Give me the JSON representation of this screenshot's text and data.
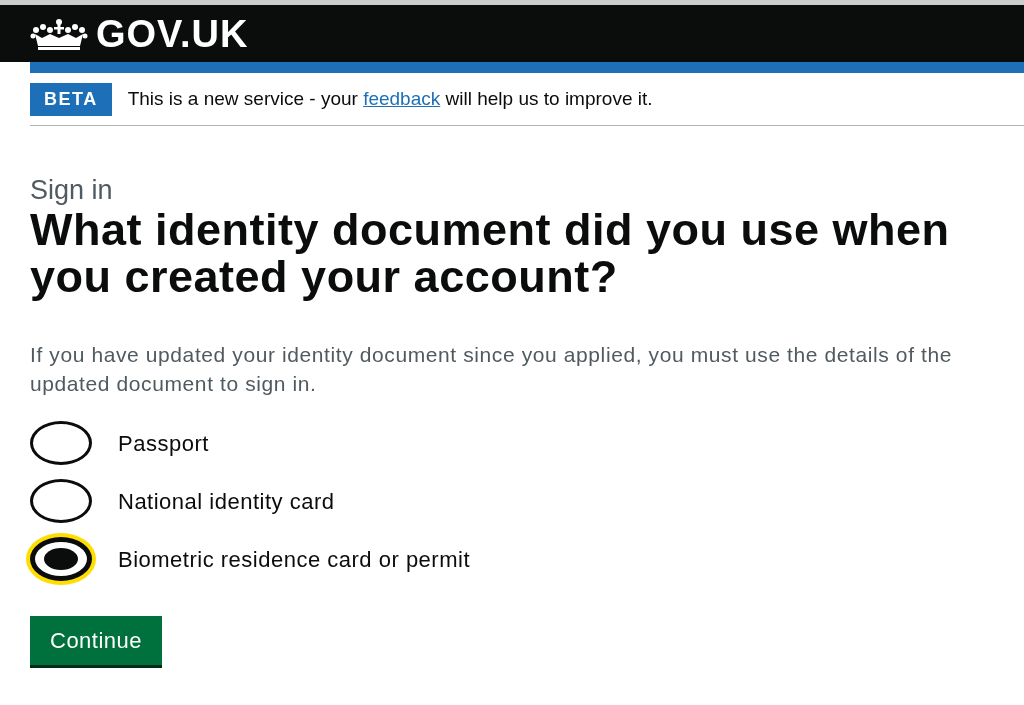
{
  "header": {
    "logo_text": "GOV.UK"
  },
  "phase_banner": {
    "tag": "BETA",
    "text_before": "This is a new service - your ",
    "link": "feedback",
    "text_after": " will help us to improve it."
  },
  "caption": "Sign in",
  "heading": "What identity document did you use when you created your account?",
  "hint": "If you have updated your identity document since you applied, you must use the details of the updated document to sign in.",
  "options": [
    {
      "label": "Passport",
      "selected": false
    },
    {
      "label": "National identity card",
      "selected": false
    },
    {
      "label": "Biometric residence card or permit",
      "selected": true
    }
  ],
  "button": "Continue"
}
